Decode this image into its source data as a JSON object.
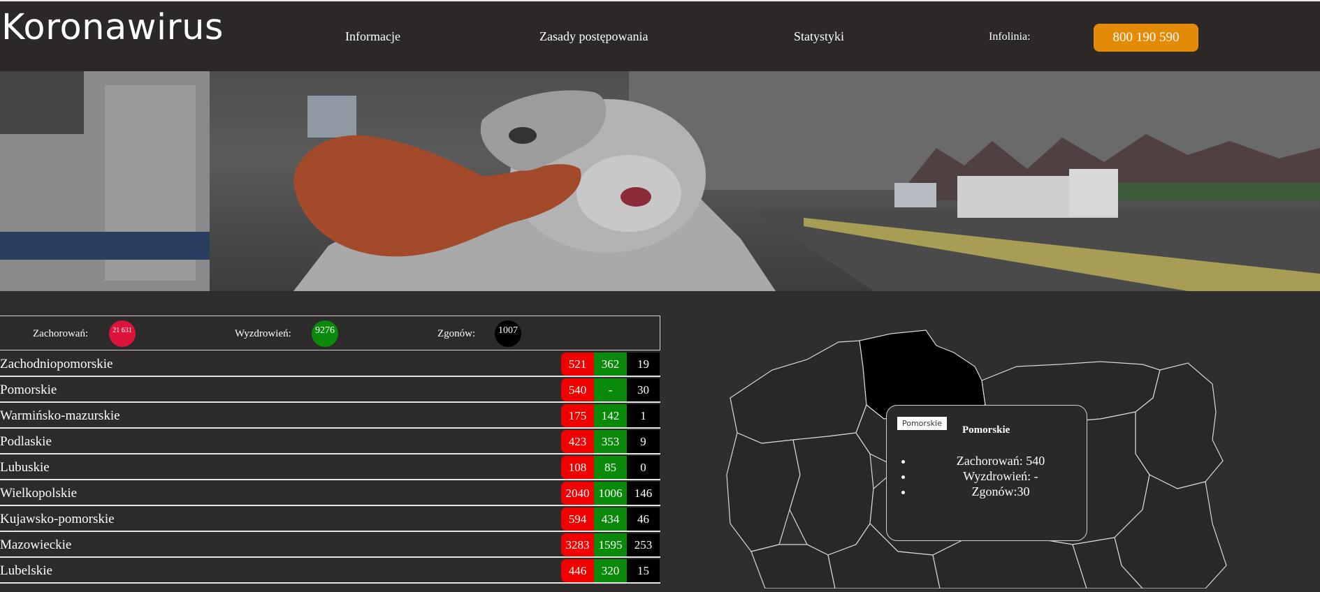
{
  "header": {
    "brand": "Koronawirus",
    "nav": [
      "Informacje",
      "Zasady postępowania",
      "Statystyki"
    ],
    "hotline_label": "Infolinia:",
    "hotline_number": "800 190 590"
  },
  "summary": {
    "infected_label": "Zachorowań:",
    "infected_value": "21 631",
    "recovered_label": "Wyzdrowień:",
    "recovered_value": "9276",
    "deaths_label": "Zgonów:",
    "deaths_value": "1007"
  },
  "regions": [
    {
      "name": "Zachodniopomorskie",
      "infected": "521",
      "recovered": "362",
      "deaths": "19"
    },
    {
      "name": "Pomorskie",
      "infected": "540",
      "recovered": "-",
      "deaths": "30"
    },
    {
      "name": "Warmińsko-mazurskie",
      "infected": "175",
      "recovered": "142",
      "deaths": "1"
    },
    {
      "name": "Podlaskie",
      "infected": "423",
      "recovered": "353",
      "deaths": "9"
    },
    {
      "name": "Lubuskie",
      "infected": "108",
      "recovered": "85",
      "deaths": "0"
    },
    {
      "name": "Wielkopolskie",
      "infected": "2040",
      "recovered": "1006",
      "deaths": "146"
    },
    {
      "name": "Kujawsko-pomorskie",
      "infected": "594",
      "recovered": "434",
      "deaths": "46"
    },
    {
      "name": "Mazowieckie",
      "infected": "3283",
      "recovered": "1595",
      "deaths": "253"
    },
    {
      "name": "Lubelskie",
      "infected": "446",
      "recovered": "320",
      "deaths": "15"
    }
  ],
  "map_tooltip": {
    "tag": "Pomorskie",
    "title": "Pomorskie",
    "lines": [
      "Zachorowań: 540",
      "Wyzdrowień: -",
      "Zgonów:30"
    ]
  },
  "colors": {
    "accent": "#e38b06",
    "infected": "#f10000",
    "recovered": "#0a8a0a",
    "deaths": "#000000",
    "summary_infected": "#dc143c",
    "summary_recovered": "#0a8a0a",
    "summary_deaths": "#000000"
  }
}
